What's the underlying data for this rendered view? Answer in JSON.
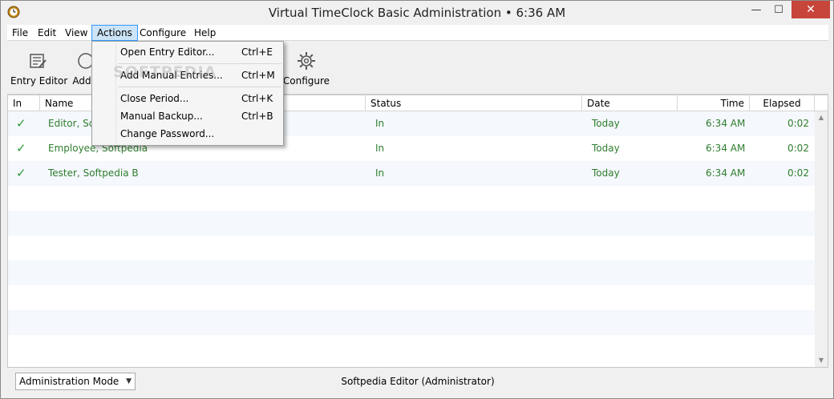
{
  "window": {
    "title": "Virtual TimeClock Basic Administration • 6:36 AM",
    "controls": {
      "minimize": "—",
      "maximize": "☐",
      "close": "✕"
    }
  },
  "menubar": {
    "items": [
      {
        "label": "File"
      },
      {
        "label": "Edit"
      },
      {
        "label": "View"
      },
      {
        "label": "Actions"
      },
      {
        "label": "Configure"
      },
      {
        "label": "Help"
      }
    ]
  },
  "toolbar": {
    "entry_editor": "Entry Editor",
    "add": "Add",
    "configure": "Configure"
  },
  "actions_menu": {
    "items": [
      {
        "label": "Open Entry Editor...",
        "shortcut": "Ctrl+E"
      },
      {
        "label": "Add Manual Entries...",
        "shortcut": "Ctrl+M"
      },
      {
        "label": "Close Period...",
        "shortcut": "Ctrl+K"
      },
      {
        "label": "Manual Backup...",
        "shortcut": "Ctrl+B"
      },
      {
        "label": "Change Password...",
        "shortcut": ""
      }
    ]
  },
  "watermark": "SOFTPEDIA",
  "grid": {
    "columns": [
      "In",
      "Name",
      "Status",
      "Date",
      "Time",
      "Elapsed"
    ],
    "rows": [
      {
        "in": "✓",
        "name": "Editor, Softpedia",
        "name_visible": "Editor, Sof",
        "status": "In",
        "date": "Today",
        "time": "6:34 AM",
        "elapsed": "0:02"
      },
      {
        "in": "✓",
        "name": "Employee, Softpedia",
        "name_visible": "Employee, Softpedia",
        "status": "In",
        "date": "Today",
        "time": "6:34 AM",
        "elapsed": "0:02"
      },
      {
        "in": "✓",
        "name": "Tester, Softpedia B",
        "name_visible": "Tester, Softpedia B",
        "status": "In",
        "date": "Today",
        "time": "6:34 AM",
        "elapsed": "0:02"
      }
    ]
  },
  "statusbar": {
    "mode": "Administration Mode",
    "user": "Softpedia Editor (Administrator)"
  },
  "colors": {
    "entry_text": "#2e7d2e",
    "check": "#2e9a3a",
    "menu_highlight": "#cce4f7",
    "close_button": "#c7453a"
  }
}
